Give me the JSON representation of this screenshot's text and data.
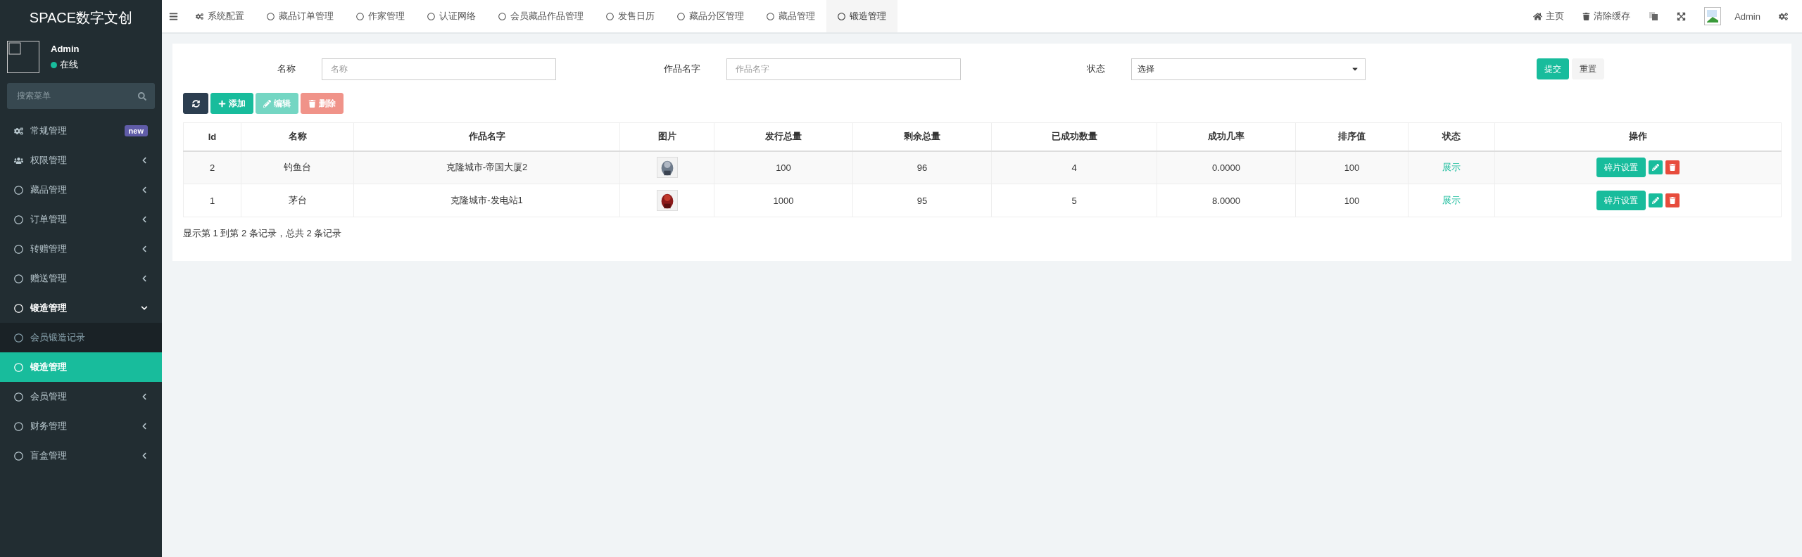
{
  "sidebar": {
    "logo": "SPACE数字文创",
    "user": {
      "name": "Admin",
      "status": "在线"
    },
    "search": {
      "placeholder": "搜索菜单"
    },
    "items": [
      {
        "label": "常规管理",
        "badge": "new",
        "expanded": false,
        "selected": false
      },
      {
        "label": "权限管理",
        "expanded": false,
        "selected": false
      },
      {
        "label": "藏品管理",
        "expanded": false,
        "selected": false
      },
      {
        "label": "订单管理",
        "expanded": false,
        "selected": false
      },
      {
        "label": "转赠管理",
        "expanded": false,
        "selected": false
      },
      {
        "label": "赠送管理",
        "expanded": false,
        "selected": false
      },
      {
        "label": "锻造管理",
        "expanded": true,
        "selected": false,
        "children": [
          {
            "label": "会员锻造记录",
            "selected": false
          },
          {
            "label": "锻造管理",
            "selected": true
          }
        ]
      },
      {
        "label": "会员管理",
        "expanded": false,
        "selected": false
      },
      {
        "label": "财务管理",
        "expanded": false,
        "selected": false
      },
      {
        "label": "盲盒管理",
        "expanded": false,
        "selected": false
      }
    ]
  },
  "top_tabs": [
    {
      "label": "系统配置",
      "selected": false
    },
    {
      "label": "藏品订单管理",
      "selected": false
    },
    {
      "label": "作家管理",
      "selected": false
    },
    {
      "label": "认证网络",
      "selected": false
    },
    {
      "label": "会员藏品作品管理",
      "selected": false
    },
    {
      "label": "发售日历",
      "selected": false
    },
    {
      "label": "藏品分区管理",
      "selected": false
    },
    {
      "label": "藏品管理",
      "selected": false
    },
    {
      "label": "锻造管理",
      "selected": true
    }
  ],
  "top_right": {
    "home": "主页",
    "clear_cache": "清除缓存",
    "user": "Admin"
  },
  "filters": [
    {
      "label": "名称",
      "placeholder": "名称",
      "kind": "input"
    },
    {
      "label": "作品名字",
      "placeholder": "作品名字",
      "kind": "input"
    },
    {
      "label": "状态",
      "value": "选择",
      "kind": "select"
    }
  ],
  "filter_buttons": [
    "提交",
    "重置"
  ],
  "toolbar": [
    {
      "kind": "refresh",
      "disabled": false
    },
    {
      "kind": "add",
      "label": "添加",
      "disabled": false
    },
    {
      "kind": "edit",
      "label": "编辑",
      "disabled": true
    },
    {
      "kind": "delete",
      "label": "删除",
      "disabled": true
    }
  ],
  "table": {
    "columns": [
      "Id",
      "名称",
      "作品名字",
      "图片",
      "发行总量",
      "剩余总量",
      "已成功数量",
      "成功几率",
      "排序值",
      "状态",
      "操作"
    ],
    "rows": [
      {
        "cells": [
          "2",
          "钓鱼台",
          "克隆城市-帝国大厦2",
          {
            "kind": "picture"
          },
          "100",
          "96",
          "4",
          "0.0000",
          "100",
          "展示"
        ],
        "action": "碎片设置"
      },
      {
        "cells": [
          "1",
          "茅台",
          "克隆城市-发电站1",
          {
            "kind": "picture"
          },
          "1000",
          "95",
          "5",
          "8.0000",
          "100",
          "展示"
        ],
        "action": "碎片设置"
      }
    ]
  },
  "pagination_info": "显示第 1 到第 2 条记录，总共 2 条记录"
}
